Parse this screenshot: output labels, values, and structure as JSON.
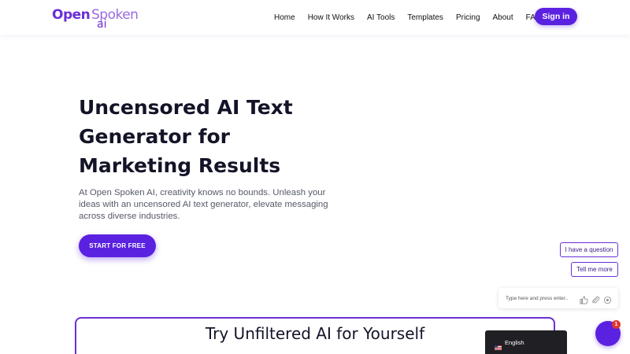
{
  "brand": {
    "logo_open": "Open",
    "logo_spoken": "Spoken",
    "logo_ai": "ai"
  },
  "nav": {
    "items": [
      "Home",
      "How It Works",
      "AI Tools",
      "Templates",
      "Pricing",
      "About",
      "FAQ"
    ],
    "signin_label": "Sign in"
  },
  "hero": {
    "title_line1": "Uncensored AI Text",
    "title_line2": "Generator for",
    "title_line3": "Marketing Results",
    "description": "At Open Spoken AI, creativity knows no bounds. Unleash your ideas with an uncensored AI text generator, elevate messaging across diverse industries.",
    "cta_label": "START FOR FREE"
  },
  "chat": {
    "suggestions": [
      "I have a question",
      "Tell me more"
    ],
    "input_placeholder": "Type here and press enter..",
    "icons": [
      "thumbs-up-icon",
      "paperclip-icon",
      "settings-icon"
    ],
    "unread_count": "1"
  },
  "try_section": {
    "title": "Try Unfiltered AI for Yourself"
  },
  "language": {
    "label": "English",
    "flag": "us-flag-icon"
  },
  "colors": {
    "accent": "#5b21e0",
    "logo_dark": "#6a2fd6",
    "logo_light": "#9b6ae0",
    "badge": "#e3342f",
    "lang_bar": "#1f1f24"
  }
}
